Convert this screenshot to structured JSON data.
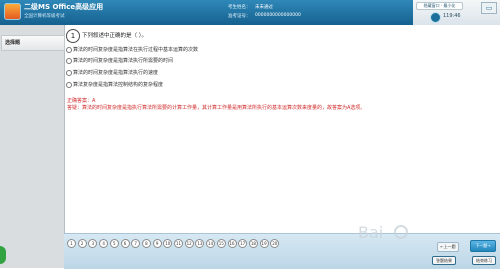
{
  "header": {
    "title": "二级MS Office高级应用",
    "subtitle": "全国计算机等级考试",
    "candidate_label": "考生姓名：",
    "candidate_name": "未未通过",
    "id_label": "准考证号：",
    "id_value": "0000000000000000",
    "hide_window_label": "隐藏窗口 · 最小化",
    "tools_icon": "window-icon",
    "timer": "119:46"
  },
  "sidebar": {
    "item_label": "选择题",
    "collapse_arrow": "◂"
  },
  "question": {
    "number": "1",
    "text": "下列叙述中正确的是（ ）。",
    "options": [
      "算法的时间复杂度是指算法在执行过程中基本运算的次数",
      "算法的时间复杂度是指算法执行所需要的时间",
      "算法的时间复杂度是指算法执行的速度",
      "算法复杂度是指算法控制结构的复杂程度"
    ],
    "answer": "正确答案：A",
    "explanation": "答疑：算法的时间复杂度是指执行算法所需要的计算工作量，其计算工作量是用算法所执行的基本运算次数来度量的，故答案为A选项。"
  },
  "nav": {
    "question_numbers": [
      "1",
      "2",
      "3",
      "4",
      "5",
      "6",
      "7",
      "8",
      "9",
      "10",
      "11",
      "12",
      "13",
      "14",
      "15",
      "16",
      "17",
      "18",
      "19",
      "20"
    ],
    "prev_label": "←上一题",
    "next_label": "下一题→",
    "check_answer_label": "答题结果",
    "exit_label": "结束练习"
  },
  "colors": {
    "header_blue": "#1f76a8",
    "answer_red": "#d22b2b",
    "next_blue": "#2187bd"
  }
}
